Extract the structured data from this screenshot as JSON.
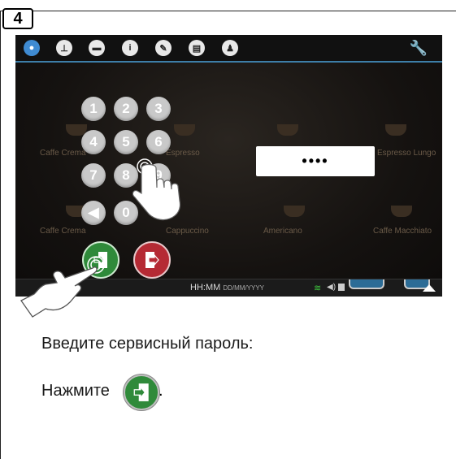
{
  "step": {
    "number": "4"
  },
  "screen": {
    "topbar_icons": [
      "water-drop-icon",
      "clock-icon",
      "cup-icon",
      "info-icon",
      "pencil-icon",
      "display-icon",
      "user-icon"
    ],
    "products": [
      "Caffe Crema",
      "Espresso",
      "Caffe Crema",
      "Espresso Lungo",
      "Caffe Crema",
      "Cappuccino",
      "Americano",
      "Caffe Macchiato"
    ],
    "keypad": {
      "keys": [
        "1",
        "2",
        "3",
        "4",
        "5",
        "6",
        "7",
        "8",
        "9",
        "◀",
        "0"
      ]
    },
    "password": {
      "masked": "••••"
    },
    "status": {
      "time": "HH:MM",
      "date": "DD/MM/YYYY"
    }
  },
  "instructions": {
    "line1": "Введите сервисный пароль:",
    "line2": "Нажмите",
    "period": "."
  },
  "colors": {
    "confirm": "#2f8a3a",
    "cancel": "#b52a34",
    "accent": "#3f8bd2",
    "topbar_line": "#3d7ea8"
  }
}
